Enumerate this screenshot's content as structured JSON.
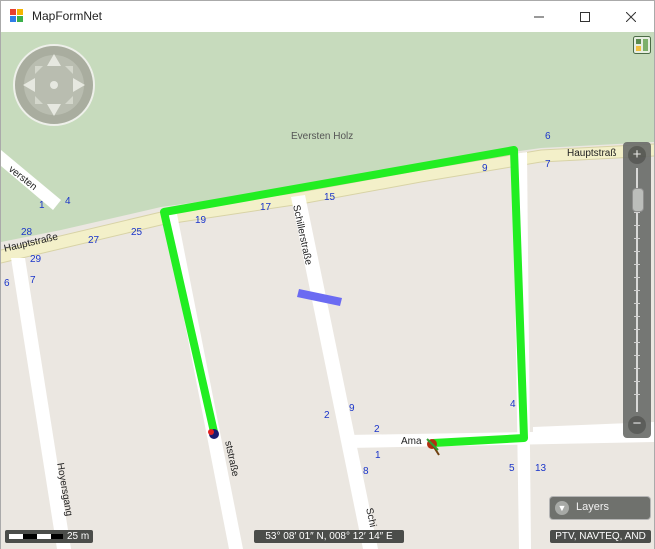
{
  "window": {
    "title": "MapFormNet",
    "minimize_icon": "minimize-icon",
    "maximize_icon": "maximize-icon",
    "close_icon": "close-icon"
  },
  "map": {
    "area_label": "Eversten Holz",
    "streets": {
      "hauptstrasse_left": "Hauptstraße",
      "hauptstrasse_right": "Hauptstraß",
      "schillerstrasse_top": "Schillerstraße",
      "schillerstrasse_bottom": "Schi",
      "eversten": "versten",
      "hoyersgang": "Hoyersgang",
      "amalien": "Ama",
      "lindenstrasse": "ststraße"
    },
    "house_numbers": [
      "6",
      "9",
      "7",
      "4",
      "1",
      "28",
      "29",
      "27",
      "25",
      "6",
      "7",
      "19",
      "17",
      "15",
      "2",
      "9",
      "2",
      "4",
      "1",
      "8",
      "5",
      "13"
    ],
    "colors": {
      "forest": "#c7dbbd",
      "route": "#22ee22",
      "road": "#ffffff",
      "major_road": "#f3f0c9",
      "highlight": "#6b6bf2",
      "house_number": "#1a35c9"
    }
  },
  "controls": {
    "pan_icon": "pan-control-icon",
    "layer_toggle_icon": "layer-toggle-icon",
    "zoom_in": "+",
    "zoom_out": "−",
    "zoom_level_fraction": 0.12,
    "layers_label": "Layers",
    "layers_icon": "chevron-down-icon"
  },
  "status": {
    "scale": "25 m",
    "coordinates": "53° 08′ 01″ N, 008° 12′ 14″ E",
    "copyright": "PTV, NAVTEQ, AND"
  }
}
